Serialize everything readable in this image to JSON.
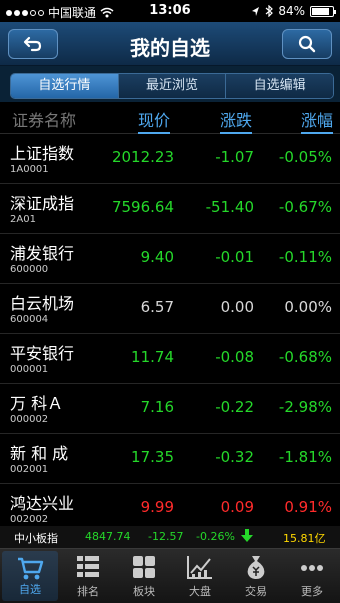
{
  "status": {
    "carrier": "中国联通",
    "time": "13:06",
    "battery": "84%",
    "signal_bars": 3
  },
  "header": {
    "title": "我的自选",
    "back_icon": "back-arrow-icon",
    "search_icon": "search-icon"
  },
  "tabs": [
    {
      "label": "自选行情",
      "active": true
    },
    {
      "label": "最近浏览",
      "active": false
    },
    {
      "label": "自选编辑",
      "active": false
    }
  ],
  "columns": {
    "name": "证券名称",
    "price": "现价",
    "change": "涨跌",
    "pct": "涨幅"
  },
  "rows": [
    {
      "name": "上证指数",
      "code": "1A0001",
      "price": "2012.23",
      "change": "-1.07",
      "pct": "-0.05%",
      "trend": "down"
    },
    {
      "name": "深证成指",
      "code": "2A01",
      "price": "7596.64",
      "change": "-51.40",
      "pct": "-0.67%",
      "trend": "down"
    },
    {
      "name": "浦发银行",
      "code": "600000",
      "price": "9.40",
      "change": "-0.01",
      "pct": "-0.11%",
      "trend": "down"
    },
    {
      "name": "白云机场",
      "code": "600004",
      "price": "6.57",
      "change": "0.00",
      "pct": "0.00%",
      "trend": "flat"
    },
    {
      "name": "平安银行",
      "code": "000001",
      "price": "11.74",
      "change": "-0.08",
      "pct": "-0.68%",
      "trend": "down"
    },
    {
      "name": "万 科Ａ",
      "code": "000002",
      "price": "7.16",
      "change": "-0.22",
      "pct": "-2.98%",
      "trend": "down"
    },
    {
      "name": "新 和 成",
      "code": "002001",
      "price": "17.35",
      "change": "-0.32",
      "pct": "-1.81%",
      "trend": "down"
    },
    {
      "name": "鸿达兴业",
      "code": "002002",
      "price": "9.99",
      "change": "0.09",
      "pct": "0.91%",
      "trend": "up"
    }
  ],
  "ticker": {
    "name": "中小板指",
    "value": "4847.74",
    "change": "-12.57",
    "pct": "-0.26%",
    "amount": "15.81亿"
  },
  "bottom_tabs": [
    {
      "label": "自选",
      "icon": "cart-icon",
      "active": true
    },
    {
      "label": "排名",
      "icon": "ranking-icon",
      "active": false
    },
    {
      "label": "板块",
      "icon": "grid-icon",
      "active": false
    },
    {
      "label": "大盘",
      "icon": "chart-icon",
      "active": false
    },
    {
      "label": "交易",
      "icon": "money-bag-icon",
      "active": false
    },
    {
      "label": "更多",
      "icon": "more-icon",
      "active": false
    }
  ],
  "colors": {
    "up": "#ff2b2b",
    "down": "#25d82a",
    "flat": "#d8d8d8",
    "accent": "#4fa8ee"
  }
}
